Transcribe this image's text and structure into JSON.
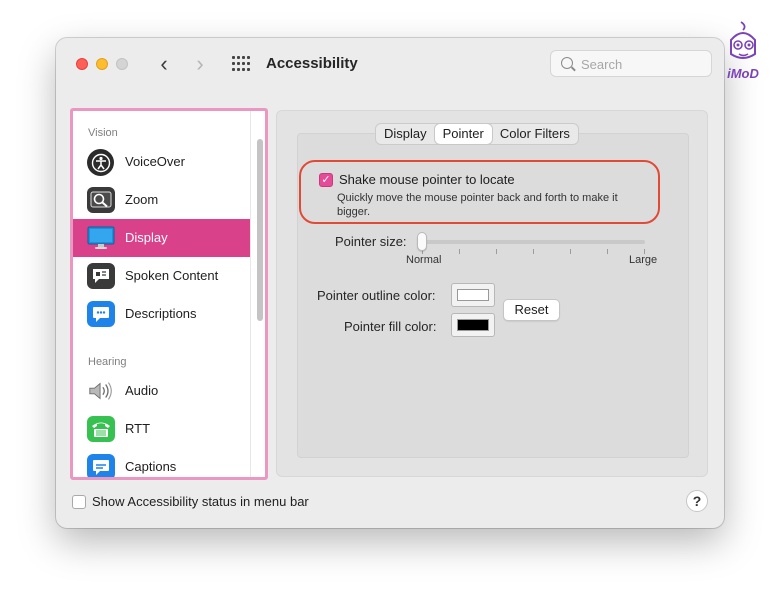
{
  "window": {
    "title": "Accessibility"
  },
  "search": {
    "placeholder": "Search"
  },
  "sidebar": {
    "sections": [
      {
        "heading": "Vision",
        "items": [
          {
            "label": "VoiceOver",
            "icon": "voiceover-icon"
          },
          {
            "label": "Zoom",
            "icon": "zoom-icon"
          },
          {
            "label": "Display",
            "icon": "display-icon",
            "selected": true
          },
          {
            "label": "Spoken Content",
            "icon": "spoken-content-icon"
          },
          {
            "label": "Descriptions",
            "icon": "descriptions-icon"
          }
        ]
      },
      {
        "heading": "Hearing",
        "items": [
          {
            "label": "Audio",
            "icon": "speaker-icon"
          },
          {
            "label": "RTT",
            "icon": "rtt-phone-icon"
          },
          {
            "label": "Captions",
            "icon": "captions-icon"
          }
        ]
      }
    ]
  },
  "tabs": [
    {
      "label": "Display",
      "active": false
    },
    {
      "label": "Pointer",
      "active": true
    },
    {
      "label": "Color Filters",
      "active": false
    }
  ],
  "pointer": {
    "shake": {
      "label": "Shake mouse pointer to locate",
      "description": "Quickly move the mouse pointer back and forth to make it bigger.",
      "checked": true
    },
    "size": {
      "label": "Pointer size:",
      "min_label": "Normal",
      "max_label": "Large",
      "value_fraction": 0.0
    },
    "outline": {
      "label": "Pointer outline color:",
      "color": "#ffffff"
    },
    "fill": {
      "label": "Pointer fill color:",
      "color": "#000000"
    },
    "reset_label": "Reset"
  },
  "footer": {
    "status_label": "Show Accessibility status in menu bar",
    "status_checked": false,
    "help_label": "?"
  },
  "watermark": {
    "text": "iMoD"
  },
  "colors": {
    "selection": "#d9428b",
    "checkbox": "#e64b98",
    "highlight": "#e04a36",
    "sidebar_frame": "#ea98c2"
  }
}
